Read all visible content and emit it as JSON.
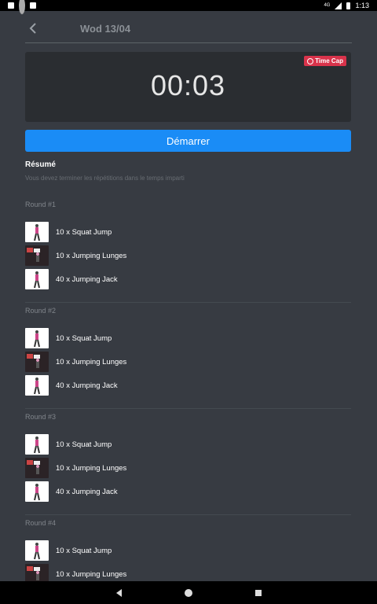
{
  "status_bar": {
    "time": "1:13",
    "signal_label": "4G"
  },
  "header": {
    "title": "Wod 13/04",
    "back_icon": "chevron-left-icon"
  },
  "timer": {
    "value": "00:03",
    "badge": "Time Cap"
  },
  "start_button": "Démarrer",
  "summary": {
    "title": "Résumé",
    "text": "Vous devez terminer les répétitions dans le temps imparti"
  },
  "rounds": [
    {
      "label": "Round #1",
      "exercises": [
        {
          "label": "10 x Squat Jump",
          "thumb": "squat"
        },
        {
          "label": "10 x Jumping Lunges",
          "thumb": "lunges"
        },
        {
          "label": "40 x Jumping Jack",
          "thumb": "jack"
        }
      ]
    },
    {
      "label": "Round #2",
      "exercises": [
        {
          "label": "10 x Squat Jump",
          "thumb": "squat"
        },
        {
          "label": "10 x Jumping Lunges",
          "thumb": "lunges"
        },
        {
          "label": "40 x Jumping Jack",
          "thumb": "jack"
        }
      ]
    },
    {
      "label": "Round #3",
      "exercises": [
        {
          "label": "10 x Squat Jump",
          "thumb": "squat"
        },
        {
          "label": "10 x Jumping Lunges",
          "thumb": "lunges"
        },
        {
          "label": "40 x Jumping Jack",
          "thumb": "jack"
        }
      ]
    },
    {
      "label": "Round #4",
      "exercises": [
        {
          "label": "10 x Squat Jump",
          "thumb": "squat"
        },
        {
          "label": "10 x Jumping Lunges",
          "thumb": "lunges"
        }
      ]
    }
  ],
  "colors": {
    "background": "#373b42",
    "accent": "#1a8cf6",
    "badge": "#d9334b",
    "card": "#2a2d31"
  }
}
